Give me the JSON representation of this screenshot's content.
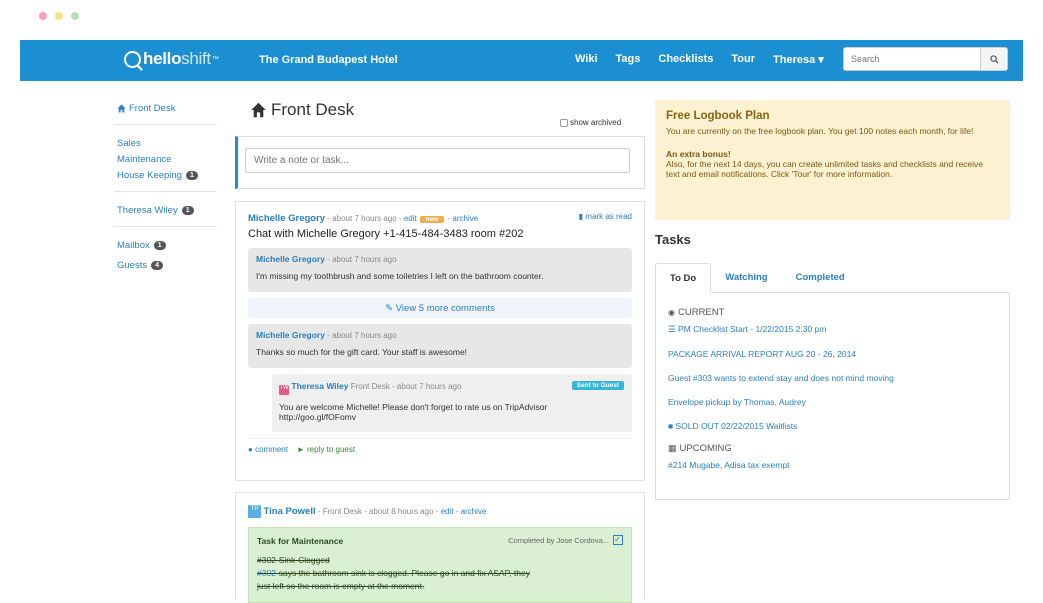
{
  "window": {
    "dots": [
      "#f7a3b3",
      "#f6e08a",
      "#b5e0b5"
    ]
  },
  "nav": {
    "logo_bold": "hello",
    "logo_light": "shift",
    "logo_tm": "™",
    "hotel": "The Grand Budapest Hotel",
    "links": [
      "Wiki",
      "Tags",
      "Checklists",
      "Tour",
      "Theresa ▾"
    ],
    "search_placeholder": "Search"
  },
  "sidebar": {
    "front_desk": "Front Desk",
    "sales": "Sales",
    "maintenance": "Maintenance",
    "housekeeping": "House Keeping",
    "housekeeping_count": "1",
    "theresa": "Theresa Wiley",
    "theresa_count": "1",
    "mailbox": "Mailbox",
    "mailbox_count": "1",
    "guests": "Guests",
    "guests_count": "4"
  },
  "main": {
    "title": "Front Desk",
    "show_archived": "show archived",
    "composer_placeholder": "Write a note or task..."
  },
  "post1": {
    "author": "Michelle Gregory",
    "meta_pre": " - about 7 hours ago - ",
    "edit": "edit",
    "new": "new",
    "archive": "archive",
    "mark_read": "mark as read",
    "title": "Chat with Michelle Gregory +1-415-484-3483 room #202",
    "c1_author": "Michelle Gregory",
    "c1_time": " - about 7 hours ago",
    "c1_text": "I'm missing my toothbrush and some toiletries I left on the bathroom counter.",
    "more_comments": "View 5 more comments",
    "c2_author": "Michelle Gregory",
    "c2_time": " - about 7 hours ago",
    "c2_text": "Thanks so much for the gift card. Your staff is awesome!",
    "r_author": "Theresa Wiley",
    "r_meta": " Front Desk - about 7 hours ago",
    "r_badge": "Sent to Guest",
    "r_text1": "You are welcome Michelle! Please don't forget to rate us on TripAdvisor",
    "r_text2": "http://goo.gl/fOFomv",
    "comment_link": "comment",
    "reply_link": "reply to guest"
  },
  "post2": {
    "author": "Tina Powell",
    "meta": " - Front Desk - about 8 hours ago - ",
    "edit": "edit",
    "archive": "archive",
    "task_label": "Task for Maintenance",
    "completed_by": "Completed by Jose Cordova...",
    "line1": "#302-Sink-Clogged",
    "line2_tag": "#302",
    "line2": "-says the bathroom sink is clogged. Please go in and fix ASAP, they",
    "line3": "just left so the room is empty at the moment."
  },
  "plan": {
    "title": "Free Logbook Plan",
    "text1": "You are currently on the free logbook plan. You get 100 notes each month, for life!",
    "bonus_title": "An extra bonus!",
    "text2": "Also, for the next 14 days, you can create unlimited tasks and checklists and receive text and email notifications. Click 'Tour' for more information."
  },
  "tasks": {
    "title": "Tasks",
    "tabs": [
      "To Do",
      "Watching",
      "Completed"
    ],
    "current": "CURRENT",
    "items": [
      "PM Checklist Start - 1/22/2015 2:30 pm",
      "PACKAGE ARRIVAL REPORT AUG 20 - 26, 2014",
      "Guest #303 wants to extend stay and does not mind moving",
      "Envelope pickup by Thomas, Audrey",
      "SOLD OUT 02/22/2015 Waitlists"
    ],
    "upcoming": "UPCOMING",
    "upcoming_items": [
      "#214 Mugabe, Adisa tax exempt"
    ]
  }
}
